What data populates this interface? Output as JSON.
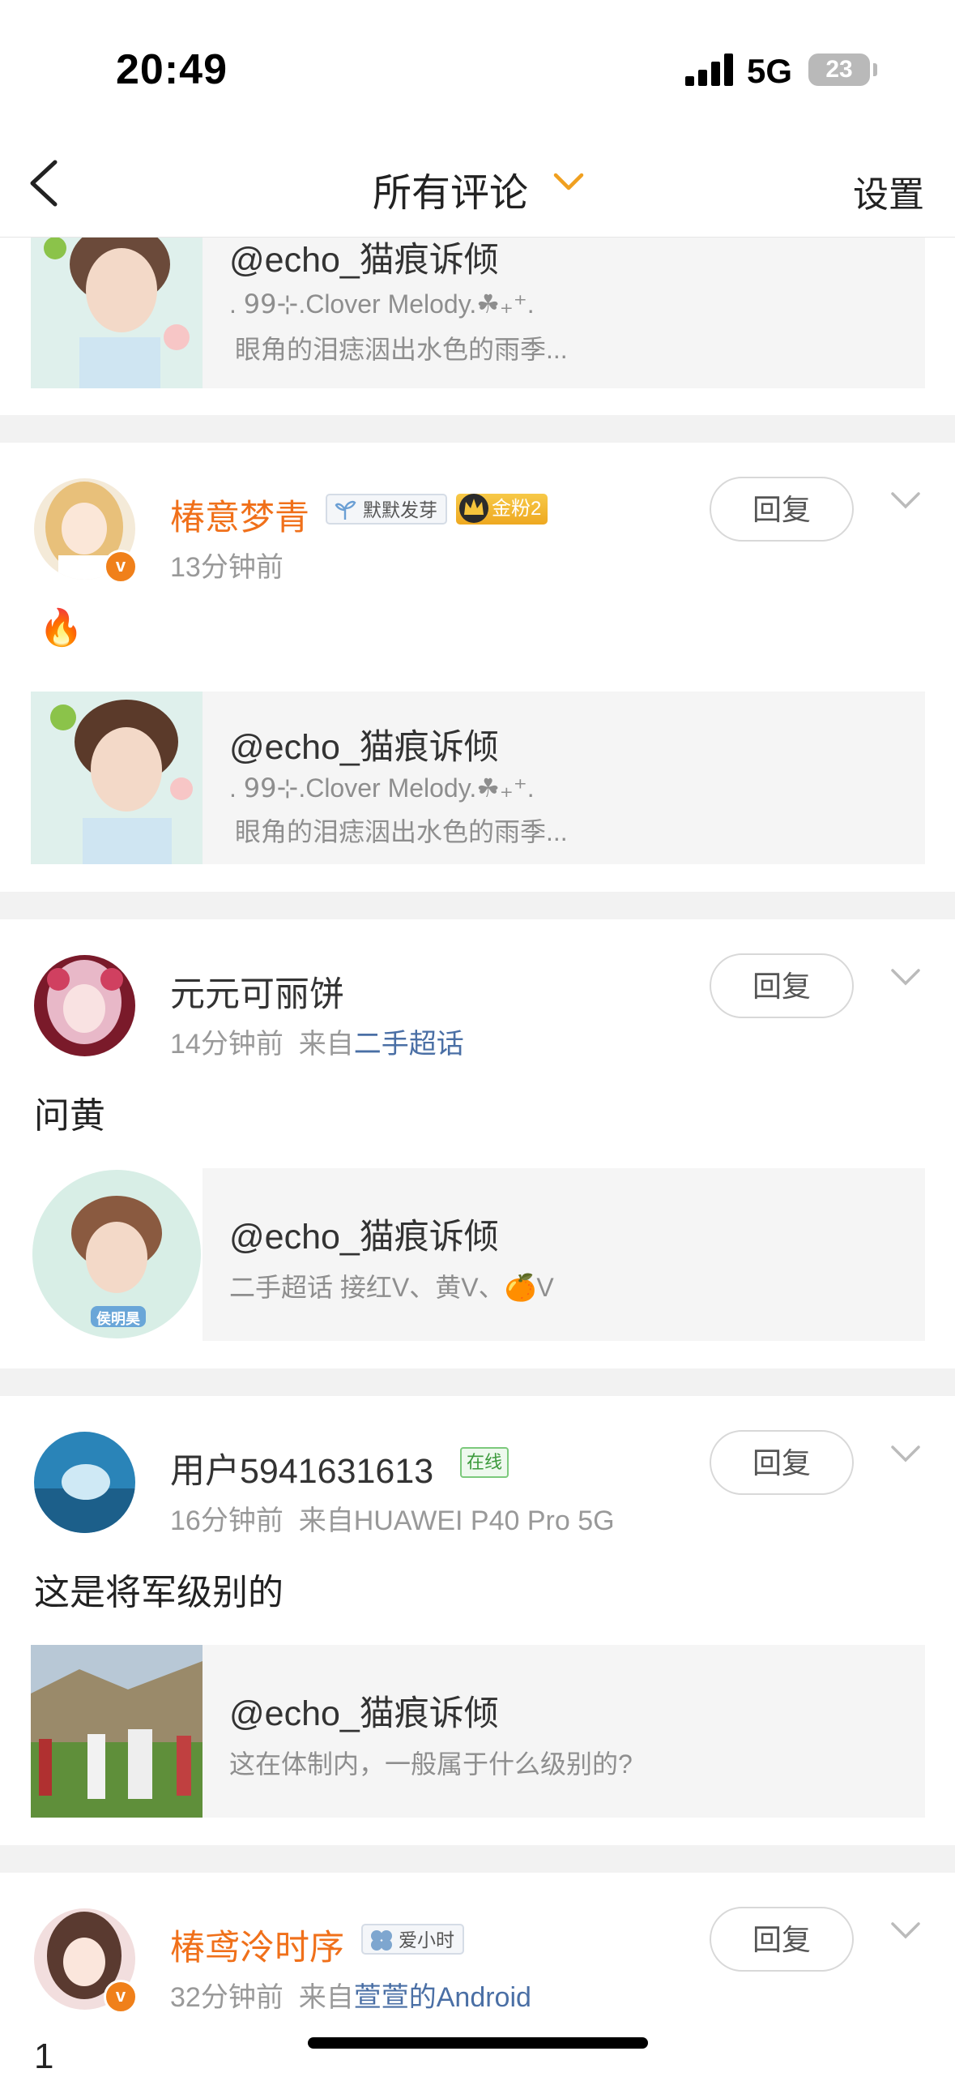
{
  "status_bar": {
    "time": "20:49",
    "network": "5G",
    "battery": "23"
  },
  "nav": {
    "title": "所有评论",
    "settings": "设置"
  },
  "comments": [
    {
      "card": {
        "title": "@echo_猫痕诉倾",
        "subtitle": ". 𝟫𝟫⊹.Clover Melody.☘₊⁺.",
        "subtitle2": "眼角的泪痣洇出水色的雨季..."
      }
    },
    {
      "name": "椿意梦青",
      "badge": "默默发芽",
      "fan_badge": "金粉2",
      "time": "13分钟前",
      "text": "🔥",
      "reply": "回复",
      "card": {
        "title": "@echo_猫痕诉倾",
        "subtitle": ". 𝟫𝟫⊹.Clover Melody.☘₊⁺.",
        "subtitle2": "眼角的泪痣洇出水色的雨季..."
      }
    },
    {
      "name": "元元可丽饼",
      "time": "14分钟前",
      "source_prefix": "来自",
      "source": "二手超话",
      "text": "问黄",
      "reply": "回复",
      "card": {
        "title": "@echo_猫痕诉倾",
        "subtitle": "二手超话    接红V、黄V、🍊V",
        "thumb_text": "侯明昊"
      }
    },
    {
      "name": "用户5941631613",
      "online": "在线",
      "time": "16分钟前",
      "source_prefix": "来自",
      "source": "HUAWEI P40 Pro 5G",
      "text": "这是将军级别的",
      "reply": "回复",
      "card": {
        "title": "@echo_猫痕诉倾",
        "subtitle": "这在体制内，一般属于什么级别的?"
      }
    },
    {
      "name": "椿鸢泠时序",
      "badge": "爱小时",
      "time": "32分钟前",
      "source_prefix": "来自",
      "source": "萱萱的Android",
      "text": "1",
      "reply": "回复"
    }
  ],
  "colors": {
    "accent_orange": "#f0701a",
    "link_blue": "#4a6fa5",
    "separator": "#f2f2f2",
    "card_bg": "#f5f5f5"
  }
}
